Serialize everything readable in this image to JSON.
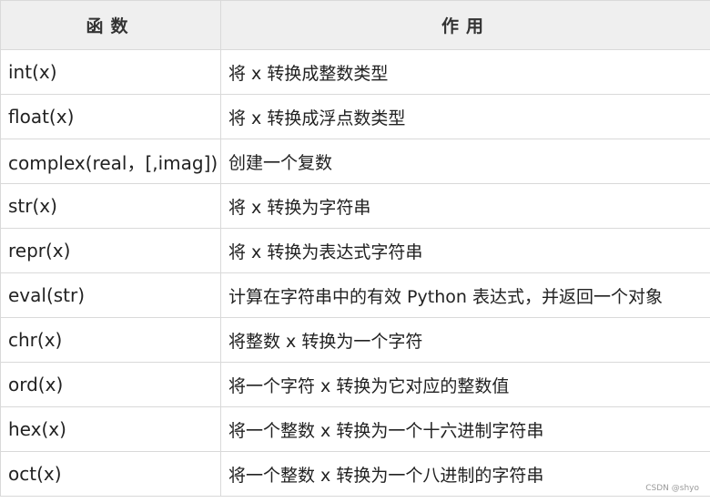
{
  "table": {
    "headers": [
      "函数",
      "作用"
    ],
    "rows": [
      [
        "int(x)",
        "将 x 转换成整数类型"
      ],
      [
        "float(x)",
        "将 x 转换成浮点数类型"
      ],
      [
        "complex(real，[,imag])",
        "创建一个复数"
      ],
      [
        "str(x)",
        "将 x 转换为字符串"
      ],
      [
        "repr(x)",
        "将 x 转换为表达式字符串"
      ],
      [
        "eval(str)",
        "计算在字符串中的有效 Python 表达式，并返回一个对象"
      ],
      [
        "chr(x)",
        "将整数 x 转换为一个字符"
      ],
      [
        "ord(x)",
        "将一个字符 x 转换为它对应的整数值"
      ],
      [
        "hex(x)",
        "将一个整数 x 转换为一个十六进制字符串"
      ],
      [
        "oct(x)",
        "将一个整数 x 转换为一个八进制的字符串"
      ]
    ]
  },
  "watermark": "CSDN @shyo"
}
